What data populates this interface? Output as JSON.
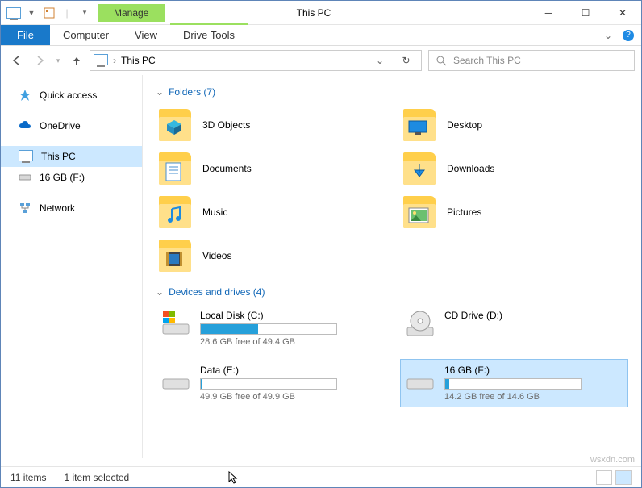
{
  "title": "This PC",
  "context_tab": "Manage",
  "ribbon": {
    "file": "File",
    "computer": "Computer",
    "view": "View",
    "drive_tools": "Drive Tools"
  },
  "address": "This PC",
  "search_placeholder": "Search This PC",
  "sidebar": {
    "quick": "Quick access",
    "onedrive": "OneDrive",
    "thispc": "This PC",
    "drive": "16 GB (F:)",
    "network": "Network"
  },
  "groups": {
    "folders": "Folders (7)",
    "drives": "Devices and drives (4)"
  },
  "folders": {
    "obj3d": "3D Objects",
    "desktop": "Desktop",
    "documents": "Documents",
    "downloads": "Downloads",
    "music": "Music",
    "pictures": "Pictures",
    "videos": "Videos"
  },
  "drives": {
    "c": {
      "name": "Local Disk (C:)",
      "free": "28.6 GB free of 49.4 GB",
      "pct": 42
    },
    "d": {
      "name": "CD Drive (D:)"
    },
    "e": {
      "name": "Data (E:)",
      "free": "49.9 GB free of 49.9 GB",
      "pct": 1
    },
    "f": {
      "name": "16 GB (F:)",
      "free": "14.2 GB free of 14.6 GB",
      "pct": 3
    }
  },
  "status": {
    "items": "11 items",
    "selected": "1 item selected"
  },
  "watermark": "wsxdn.com"
}
